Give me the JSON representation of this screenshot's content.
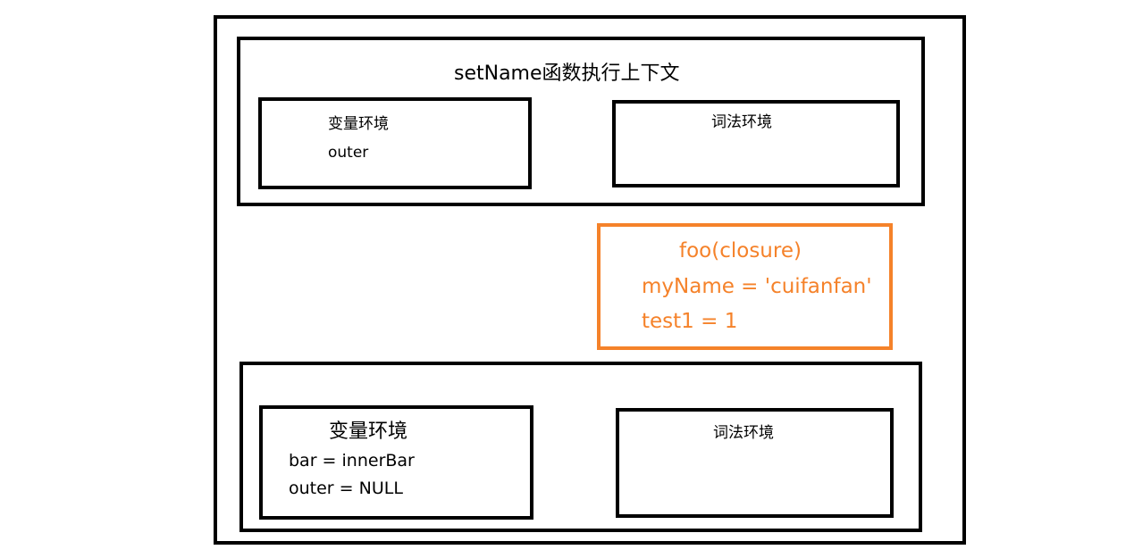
{
  "colors": {
    "frame": "#000000",
    "closure_accent": "#f5822a",
    "background": "#ffffff"
  },
  "setname_context": {
    "title": "setName函数执行上下文",
    "variable_env": {
      "label": "变量环境",
      "entries": [
        "outer"
      ]
    },
    "lexical_env": {
      "label": "词法环境"
    }
  },
  "closure": {
    "title": "foo(closure)",
    "entries": [
      "myName = 'cuifanfan'",
      "test1 = 1"
    ]
  },
  "bottom_context": {
    "variable_env": {
      "label": "变量环境",
      "entries": [
        "bar = innerBar",
        "outer = NULL"
      ]
    },
    "lexical_env": {
      "label": "词法环境"
    }
  }
}
